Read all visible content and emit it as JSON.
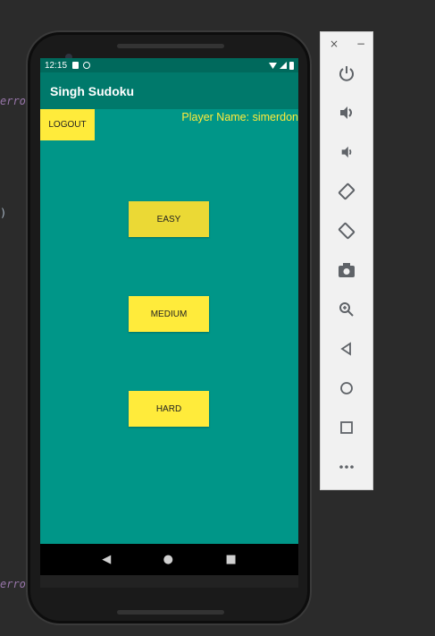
{
  "ide": {
    "line1": "error",
    "line2": ")",
    "line3": "error"
  },
  "status": {
    "time": "12:15"
  },
  "app": {
    "title": "Singh Sudoku",
    "logout_label": "LOGOUT",
    "player_label": "Player Name: simerdon",
    "buttons": [
      {
        "label": "EASY",
        "color": "#ebd935"
      },
      {
        "label": "MEDIUM",
        "color": "#ffeb3b"
      },
      {
        "label": "HARD",
        "color": "#ffeb3b"
      }
    ]
  },
  "navigation": {
    "back_icon": "◀",
    "home_icon": "●",
    "overview_icon": "■"
  },
  "emulator_toolbar": {
    "close_icon": "×",
    "minimize_icon": "−",
    "items": [
      {
        "name": "power-icon",
        "glyph": "⏻"
      },
      {
        "name": "volume-up-icon",
        "glyph": "🔊"
      },
      {
        "name": "volume-down-icon",
        "glyph": "🔉"
      },
      {
        "name": "rotate-left-icon",
        "glyph": "⟲"
      },
      {
        "name": "rotate-right-icon",
        "glyph": "⟳"
      },
      {
        "name": "camera-icon",
        "glyph": "📷"
      },
      {
        "name": "zoom-icon",
        "glyph": "🔍"
      },
      {
        "name": "back-icon",
        "glyph": "◁"
      },
      {
        "name": "home-icon",
        "glyph": "○"
      },
      {
        "name": "overview-icon",
        "glyph": "□"
      },
      {
        "name": "more-icon",
        "glyph": "•••"
      }
    ]
  },
  "colors": {
    "screen_bg": "#009688",
    "appbar_bg": "#00796b",
    "statusbar_bg": "#00695c",
    "accent": "#ffeb3b"
  }
}
